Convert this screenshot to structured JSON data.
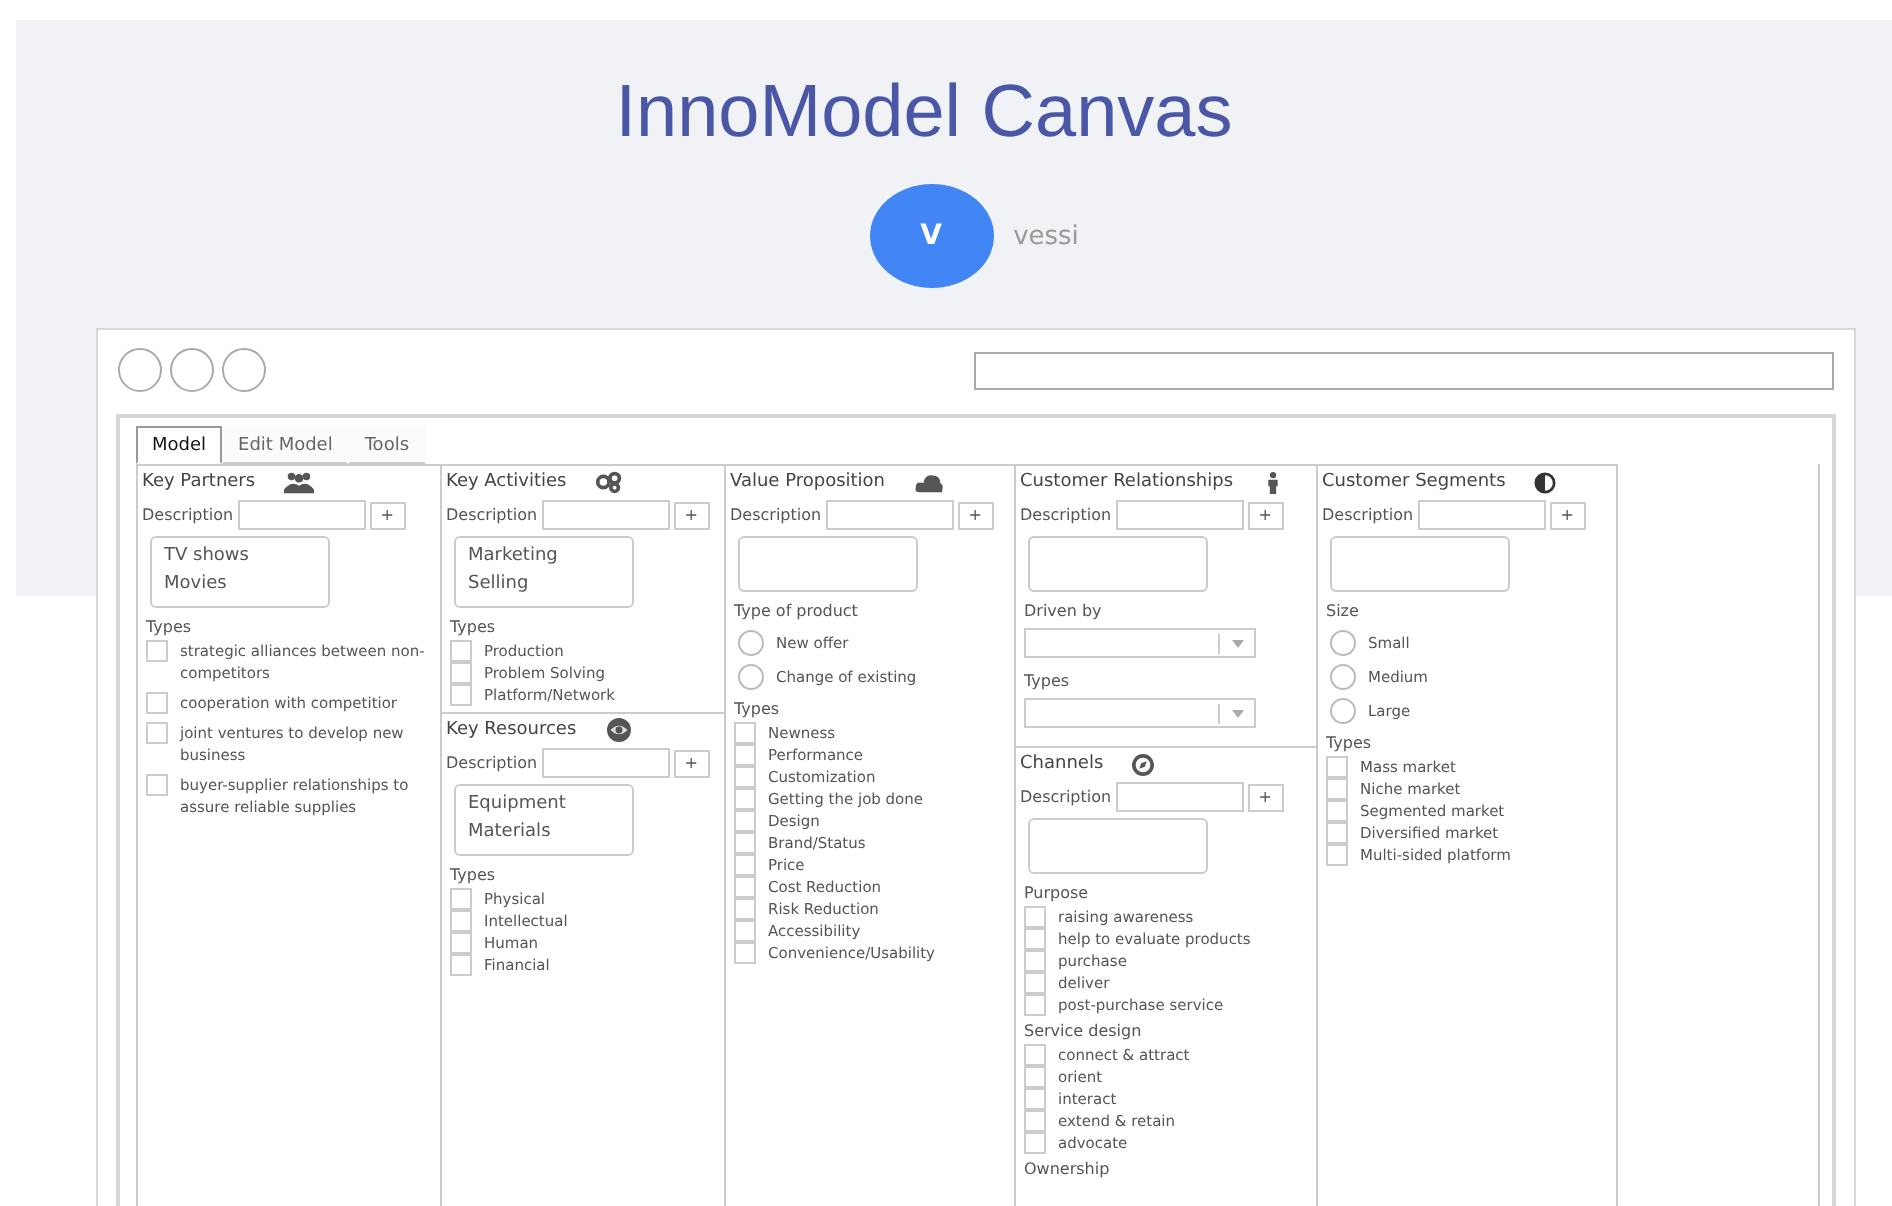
{
  "page": {
    "title": "InnoModel Canvas",
    "user": {
      "initial": "V",
      "name": "vessi"
    }
  },
  "tabs": [
    {
      "label": "Model",
      "selected": true
    },
    {
      "label": "Edit Model",
      "selected": false
    },
    {
      "label": "Tools",
      "selected": false
    }
  ],
  "columns": [
    [
      {
        "title": "Key Partners",
        "fields": [
          {
            "kind": "description",
            "label": "Description",
            "button": "+"
          },
          {
            "kind": "list",
            "items": [
              "TV shows",
              "Movies"
            ]
          },
          {
            "kind": "heading",
            "text": "Types"
          },
          {
            "kind": "checkbox",
            "label": "strategic alliances between non-competitors",
            "checked": false
          },
          {
            "kind": "checkbox",
            "label": "cooperation with competitior",
            "checked": false
          },
          {
            "kind": "checkbox",
            "label": "joint ventures to develop new business",
            "checked": false
          },
          {
            "kind": "checkbox",
            "label": "buyer-supplier relationships to assure reliable supplies",
            "checked": false
          }
        ]
      }
    ],
    [
      {
        "title": "Key Activities",
        "fields": [
          {
            "kind": "description",
            "label": "Description",
            "button": "+"
          },
          {
            "kind": "list",
            "items": [
              "Marketing",
              "Selling"
            ]
          },
          {
            "kind": "heading",
            "text": "Types"
          },
          {
            "kind": "checkbox",
            "label": "Production",
            "checked": false
          },
          {
            "kind": "checkbox",
            "label": "Problem Solving",
            "checked": false
          },
          {
            "kind": "checkbox",
            "label": "Platform/Network",
            "checked": false
          }
        ]
      },
      {
        "title": "Key Resources",
        "fields": [
          {
            "kind": "description",
            "label": "Description",
            "button": "+"
          },
          {
            "kind": "list",
            "items": [
              "Equipment",
              "Materials"
            ]
          },
          {
            "kind": "heading",
            "text": "Types"
          },
          {
            "kind": "checkbox",
            "label": "Physical",
            "checked": false
          },
          {
            "kind": "checkbox",
            "label": "Intellectual",
            "checked": false
          },
          {
            "kind": "checkbox",
            "label": "Human",
            "checked": false
          },
          {
            "kind": "checkbox",
            "label": "Financial",
            "checked": false
          }
        ]
      }
    ],
    [
      {
        "title": "Value Proposition",
        "fields": [
          {
            "kind": "description",
            "label": "Description",
            "button": "+"
          },
          {
            "kind": "box"
          },
          {
            "kind": "heading",
            "text": "Type of product"
          },
          {
            "kind": "radio",
            "label": "New offer",
            "selected": false
          },
          {
            "kind": "radio",
            "label": "Change of existing",
            "selected": false
          },
          {
            "kind": "heading",
            "text": "Types"
          },
          {
            "kind": "checkbox",
            "label": "Newness",
            "checked": false
          },
          {
            "kind": "checkbox",
            "label": "Performance",
            "checked": false
          },
          {
            "kind": "checkbox",
            "label": "Customization",
            "checked": false
          },
          {
            "kind": "checkbox",
            "label": "Getting the job done",
            "checked": false
          },
          {
            "kind": "checkbox",
            "label": "Design",
            "checked": false
          },
          {
            "kind": "checkbox",
            "label": "Brand/Status",
            "checked": false
          },
          {
            "kind": "checkbox",
            "label": "Price",
            "checked": false
          },
          {
            "kind": "checkbox",
            "label": "Cost Reduction",
            "checked": false
          },
          {
            "kind": "checkbox",
            "label": "Risk Reduction",
            "checked": false
          },
          {
            "kind": "checkbox",
            "label": "Accessibility",
            "checked": false
          },
          {
            "kind": "checkbox",
            "label": "Convenience/Usability",
            "checked": false
          }
        ]
      }
    ],
    [
      {
        "title": "Customer Relationships",
        "fields": [
          {
            "kind": "description",
            "label": "Description",
            "button": "+"
          },
          {
            "kind": "box"
          },
          {
            "kind": "heading",
            "text": "Driven by"
          },
          {
            "kind": "select"
          },
          {
            "kind": "heading",
            "text": "Types"
          },
          {
            "kind": "select"
          }
        ]
      },
      {
        "title": "Channels",
        "fields": [
          {
            "kind": "description",
            "label": "Description",
            "button": "+"
          },
          {
            "kind": "box"
          },
          {
            "kind": "heading",
            "text": "Purpose"
          },
          {
            "kind": "checkbox",
            "label": "raising awareness",
            "checked": false
          },
          {
            "kind": "checkbox",
            "label": "help to evaluate products",
            "checked": false
          },
          {
            "kind": "checkbox",
            "label": "purchase",
            "checked": false
          },
          {
            "kind": "checkbox",
            "label": "deliver",
            "checked": false
          },
          {
            "kind": "checkbox",
            "label": "post-purchase service",
            "checked": false
          },
          {
            "kind": "heading",
            "text": "Service design"
          },
          {
            "kind": "checkbox",
            "label": "connect & attract",
            "checked": false
          },
          {
            "kind": "checkbox",
            "label": "orient",
            "checked": false
          },
          {
            "kind": "checkbox",
            "label": "interact",
            "checked": false
          },
          {
            "kind": "checkbox",
            "label": "extend & retain",
            "checked": false
          },
          {
            "kind": "checkbox",
            "label": "advocate",
            "checked": false
          },
          {
            "kind": "heading",
            "text": "Ownership"
          }
        ]
      }
    ],
    [
      {
        "title": "Customer Segments",
        "fields": [
          {
            "kind": "description",
            "label": "Description",
            "button": "+"
          },
          {
            "kind": "box"
          },
          {
            "kind": "heading",
            "text": "Size"
          },
          {
            "kind": "radio",
            "label": "Small",
            "selected": false
          },
          {
            "kind": "radio",
            "label": "Medium",
            "selected": false
          },
          {
            "kind": "radio",
            "label": "Large",
            "selected": false
          },
          {
            "kind": "heading",
            "text": "Types"
          },
          {
            "kind": "checkbox",
            "label": "Mass market",
            "checked": false
          },
          {
            "kind": "checkbox",
            "label": "Niche market",
            "checked": false
          },
          {
            "kind": "checkbox",
            "label": "Segmented market",
            "checked": false
          },
          {
            "kind": "checkbox",
            "label": "Diversified market",
            "checked": false
          },
          {
            "kind": "checkbox",
            "label": "Multi-sided platform",
            "checked": false
          }
        ]
      }
    ]
  ]
}
